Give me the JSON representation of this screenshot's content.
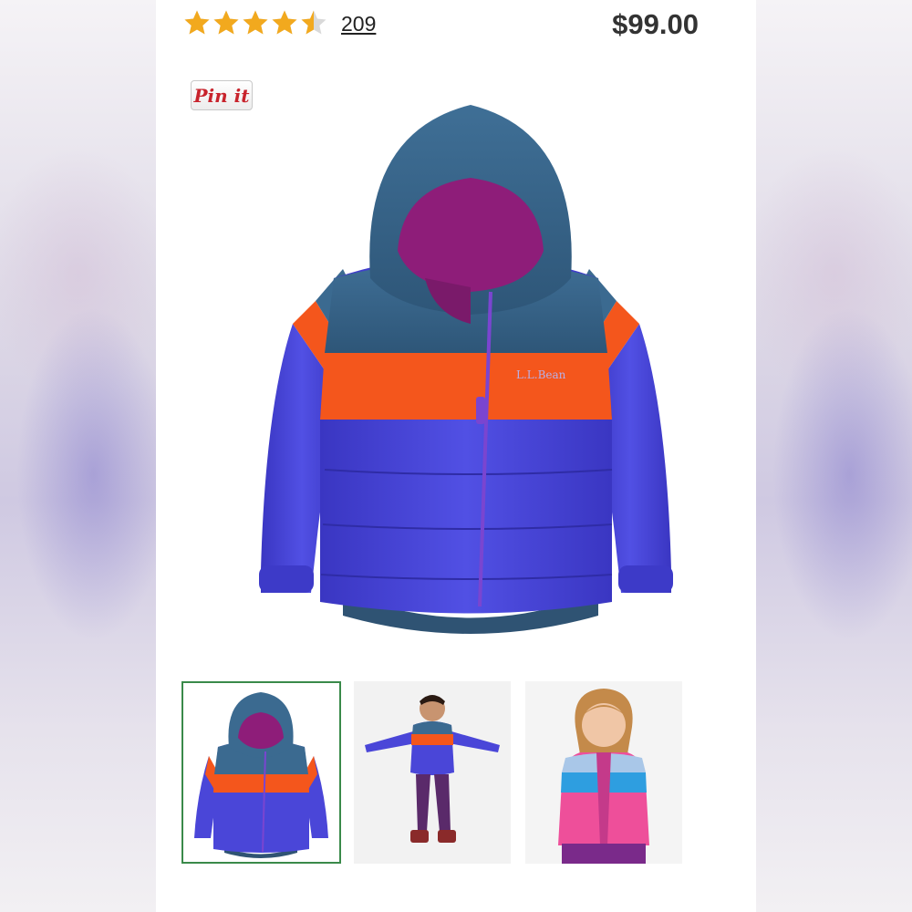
{
  "product": {
    "rating": 4.5,
    "rating_max": 5,
    "review_count": "209",
    "price": "$99.00"
  },
  "share": {
    "pin_label": "Pin it"
  },
  "gallery": {
    "main_image": "kids-puffer-jacket-hooded",
    "thumbnails": [
      {
        "name": "jacket-front",
        "selected": true
      },
      {
        "name": "boy-wearing-jacket",
        "selected": false
      },
      {
        "name": "girl-wearing-jacket-pink",
        "selected": false
      }
    ]
  },
  "colors": {
    "star": "#f2a91e",
    "price": "#333333",
    "pin": "#c8232c",
    "jacket_top": "#3b6a90",
    "jacket_stripe": "#f4561c",
    "jacket_body": "#4a46d8",
    "jacket_lining": "#9a1e82",
    "selected_border": "#3a8a4a"
  }
}
